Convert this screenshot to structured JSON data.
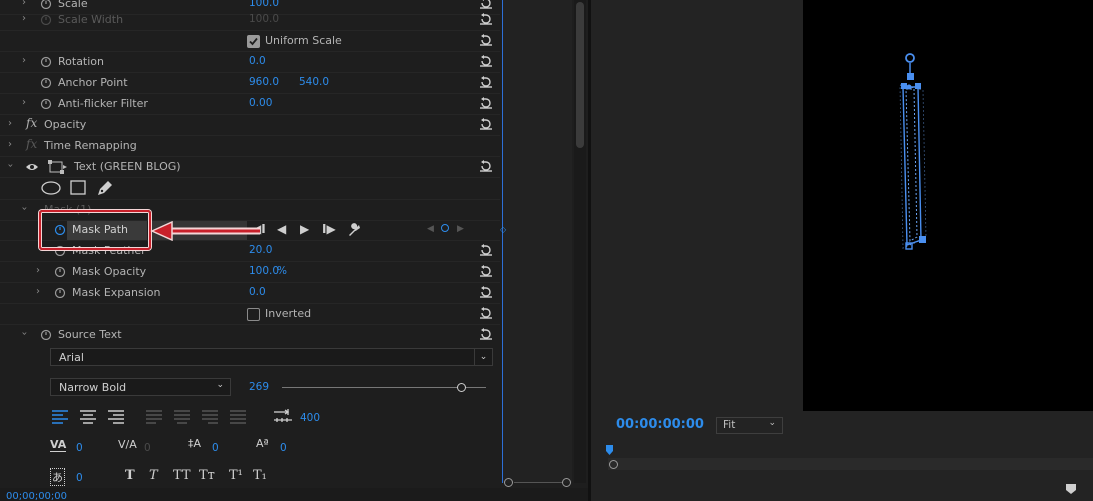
{
  "effects": {
    "scale": {
      "label": "Scale",
      "value": "100.0"
    },
    "scale_width": {
      "label": "Scale Width",
      "value": "100.0"
    },
    "uniform_scale": {
      "label": "Uniform Scale",
      "checked": true
    },
    "rotation": {
      "label": "Rotation",
      "value": "0.0"
    },
    "anchor_point": {
      "label": "Anchor Point",
      "x": "960.0",
      "y": "540.0"
    },
    "anti_flicker": {
      "label": "Anti-flicker Filter",
      "value": "0.00"
    },
    "opacity": {
      "label": "Opacity"
    },
    "time_remapping": {
      "label": "Time Remapping"
    },
    "text_layer": {
      "label": "Text (GREEN BLOG)"
    },
    "mask": {
      "label": "Mask (1)"
    },
    "mask_path": {
      "label": "Mask Path"
    },
    "mask_feather": {
      "label": "Mask Feather",
      "value": "20.0"
    },
    "mask_opacity": {
      "label": "Mask Opacity",
      "value": "100.0",
      "unit": "%"
    },
    "mask_expansion": {
      "label": "Mask Expansion",
      "value": "0.0"
    },
    "inverted": {
      "label": "Inverted",
      "checked": false
    },
    "source_text": {
      "label": "Source Text"
    }
  },
  "text_props": {
    "font": "Arial",
    "style": "Narrow Bold",
    "size": "269",
    "size_slider_fraction": 0.88,
    "tab_value": "400",
    "kerning": "0",
    "tracking": "0",
    "leading": "0",
    "baseline": "0",
    "tsume": "0",
    "style_buttons": [
      "T",
      "T",
      "TT",
      "Tт",
      "T¹",
      "T₁"
    ]
  },
  "footer": {
    "time": "00;00;00;00"
  },
  "monitor": {
    "timecode": "00:00:00:00",
    "zoom": "Fit"
  },
  "colors": {
    "accent": "#2d8ceb",
    "highlight": "#c8202a"
  }
}
